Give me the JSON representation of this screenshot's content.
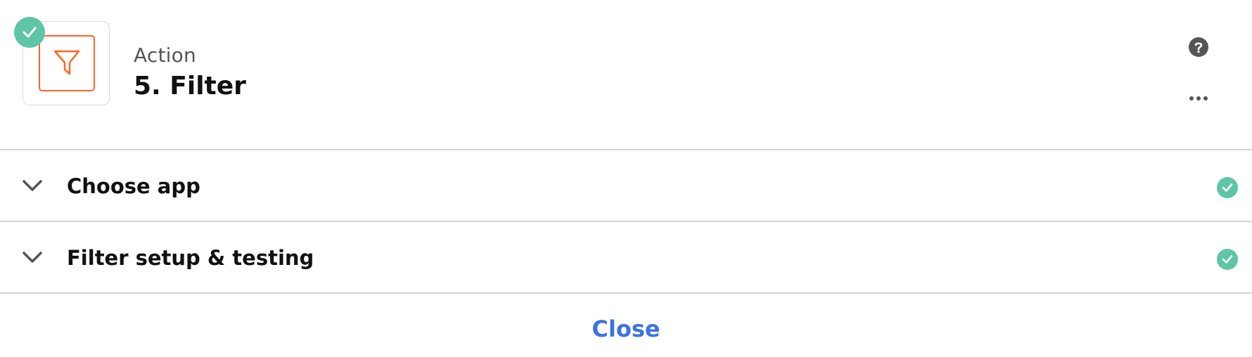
{
  "header": {
    "step_type": "Action",
    "step_title": "5. Filter",
    "app_icon": "filter-funnel-icon",
    "status_icon": "check-icon",
    "help_icon": "help-icon",
    "more_icon": "more-options-icon"
  },
  "sections": [
    {
      "label": "Choose app",
      "expand_icon": "chevron-down-icon",
      "status_icon": "check-icon"
    },
    {
      "label": "Filter setup & testing",
      "expand_icon": "chevron-down-icon",
      "status_icon": "check-icon"
    }
  ],
  "footer": {
    "close_label": "Close"
  },
  "colors": {
    "accent_green": "#5ec5a7",
    "brand_orange": "#ff4a00",
    "link_blue": "#3c72e8"
  }
}
